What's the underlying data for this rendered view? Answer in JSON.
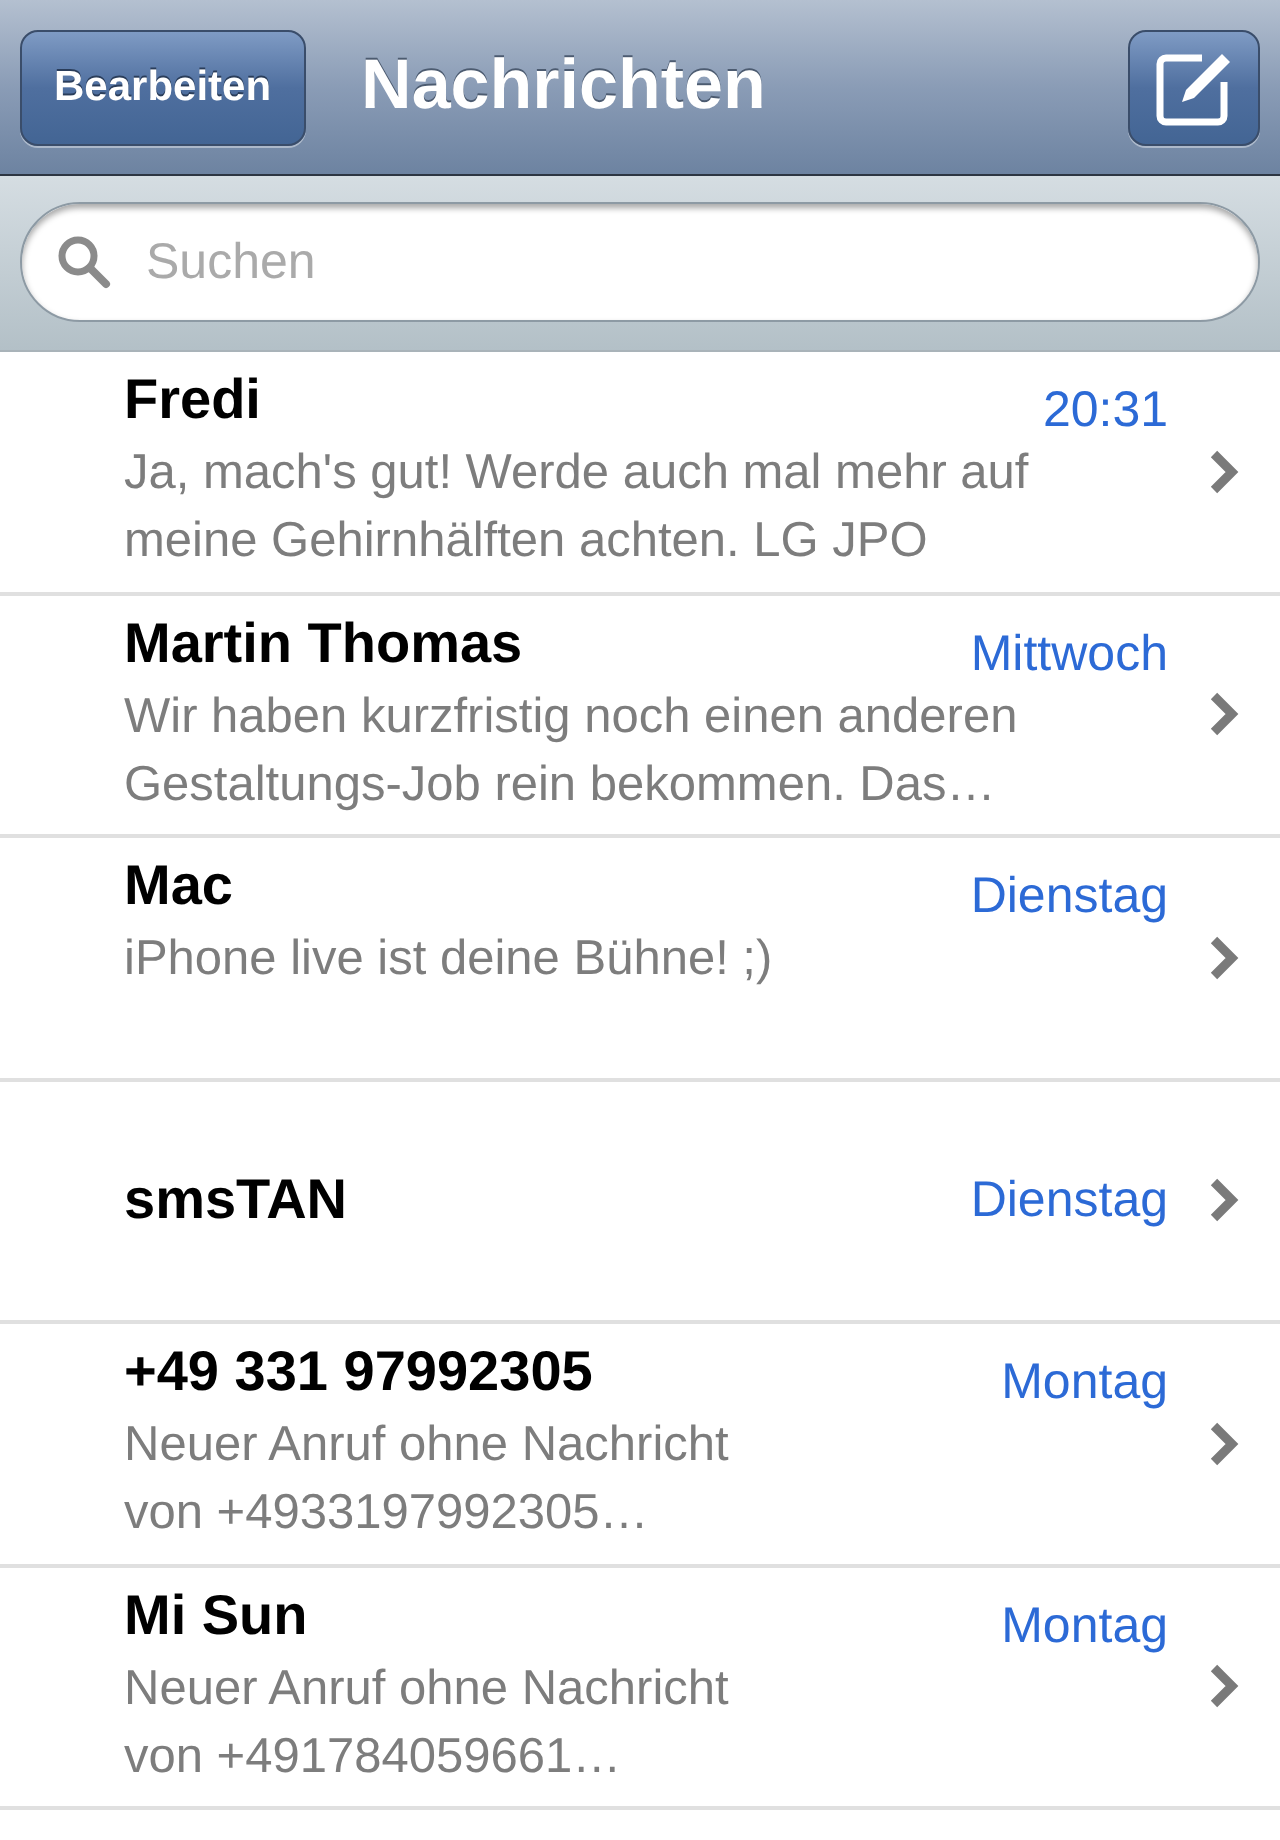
{
  "navigation_bar": {
    "edit_button": "Bearbeiten",
    "title": "Nachrichten"
  },
  "search": {
    "placeholder": "Suchen"
  },
  "conversations": [
    {
      "name": "Fredi",
      "date": "20:31",
      "preview_lines": [
        "Ja, mach's gut! Werde auch mal mehr auf",
        "meine Gehirnhälften achten. LG JPO"
      ]
    },
    {
      "name": "Martin Thomas",
      "date": "Mittwoch",
      "preview_lines": [
        "Wir haben kurzfristig noch einen anderen",
        "Gestaltungs-Job rein bekommen. Das…"
      ]
    },
    {
      "name": "Mac",
      "date": "Dienstag",
      "preview_lines": [
        "iPhone live ist deine Bühne! ;)"
      ]
    },
    {
      "name": "smsTAN",
      "date": "Dienstag"
    },
    {
      "name": "+49 331 97992305",
      "date": "Montag",
      "preview_lines": [
        "Neuer Anruf ohne Nachricht",
        "von +4933197992305…"
      ]
    },
    {
      "name": "Mi Sun",
      "date": "Montag",
      "preview_lines": [
        "Neuer Anruf ohne Nachricht",
        "von +491784059661…"
      ]
    }
  ]
}
